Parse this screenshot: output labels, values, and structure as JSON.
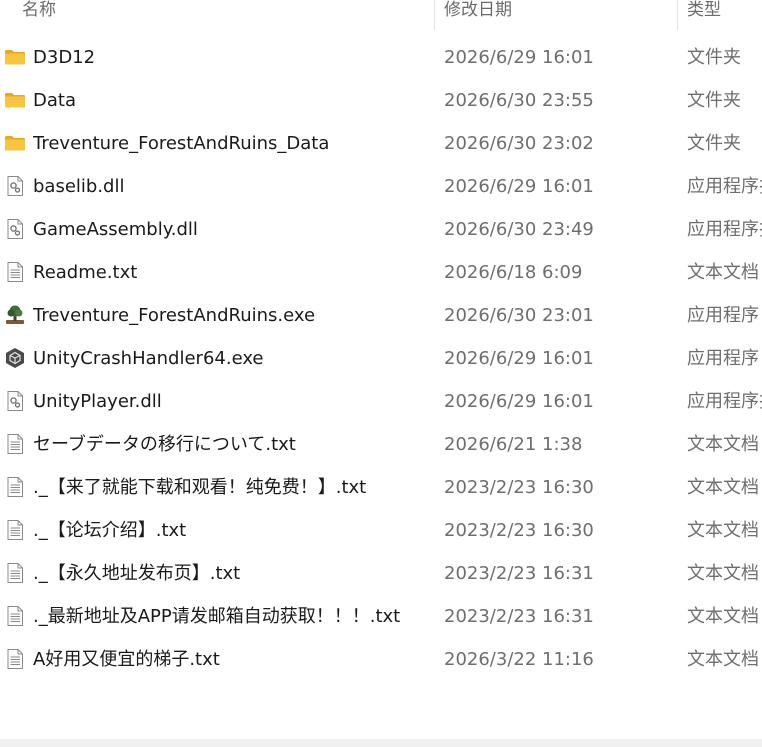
{
  "header": {
    "name": "名称",
    "date": "修改日期",
    "type": "类型"
  },
  "files": [
    {
      "icon": "folder-icon",
      "name": "D3D12",
      "date": "2026/6/29 16:01",
      "type": "文件夹"
    },
    {
      "icon": "folder-icon",
      "name": "Data",
      "date": "2026/6/30 23:55",
      "type": "文件夹"
    },
    {
      "icon": "folder-icon",
      "name": "Treventure_ForestAndRuins_Data",
      "date": "2026/6/30 23:02",
      "type": "文件夹"
    },
    {
      "icon": "dll-file-icon",
      "name": "baselib.dll",
      "date": "2026/6/29 16:01",
      "type": "应用程序扩展"
    },
    {
      "icon": "dll-file-icon",
      "name": "GameAssembly.dll",
      "date": "2026/6/30 23:49",
      "type": "应用程序扩展"
    },
    {
      "icon": "text-file-icon",
      "name": "Readme.txt",
      "date": "2026/6/18 6:09",
      "type": "文本文档"
    },
    {
      "icon": "tree-app-icon",
      "name": "Treventure_ForestAndRuins.exe",
      "date": "2026/6/30 23:01",
      "type": "应用程序"
    },
    {
      "icon": "unity-icon",
      "name": "UnityCrashHandler64.exe",
      "date": "2026/6/29 16:01",
      "type": "应用程序"
    },
    {
      "icon": "dll-file-icon",
      "name": "UnityPlayer.dll",
      "date": "2026/6/29 16:01",
      "type": "应用程序扩展"
    },
    {
      "icon": "text-file-icon",
      "name": "セーブデータの移行について.txt",
      "date": "2026/6/21 1:38",
      "type": "文本文档"
    },
    {
      "icon": "text-file-icon",
      "name": "._【来了就能下载和观看！纯免费！】.txt",
      "date": "2023/2/23 16:30",
      "type": "文本文档"
    },
    {
      "icon": "text-file-icon",
      "name": "._【论坛介绍】.txt",
      "date": "2023/2/23 16:30",
      "type": "文本文档"
    },
    {
      "icon": "text-file-icon",
      "name": "._【永久地址发布页】.txt",
      "date": "2023/2/23 16:31",
      "type": "文本文档"
    },
    {
      "icon": "text-file-icon",
      "name": "._最新地址及APP请发邮箱自动获取！！！.txt",
      "date": "2023/2/23 16:31",
      "type": "文本文档"
    },
    {
      "icon": "text-file-icon",
      "name": "A好用又便宜的梯子.txt",
      "date": "2026/3/22 11:16",
      "type": "文本文档"
    }
  ],
  "colors": {
    "folder": "#f8c541",
    "selection_hover": "#e5f3ff",
    "secondary_text": "#6e6e6e"
  }
}
